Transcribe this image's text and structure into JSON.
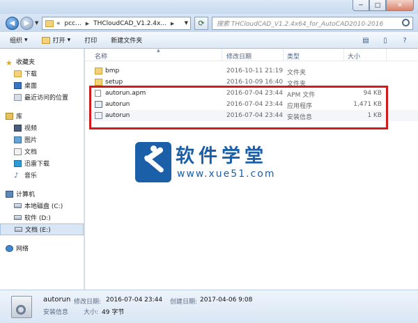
{
  "window": {
    "minimize": "─",
    "maximize": "□",
    "close": "✕"
  },
  "address": {
    "overflow": "«",
    "crumbs": [
      "pcc...",
      "THCloudCAD_V1.2.4x..."
    ],
    "separator": "▶"
  },
  "search": {
    "placeholder": "搜索 THCloudCAD_V1.2.4x64_for_AutoCAD2010-2016"
  },
  "toolbar": {
    "organize": "组织",
    "open": "打开",
    "print": "打印",
    "new_folder": "新建文件夹",
    "dropdown": "▼"
  },
  "sidebar": {
    "favorites": {
      "label": "收藏夹",
      "items": [
        "下载",
        "桌面",
        "最近访问的位置"
      ]
    },
    "libraries": {
      "label": "库",
      "items": [
        "视频",
        "图片",
        "文档",
        "迅雷下载",
        "音乐"
      ]
    },
    "computer": {
      "label": "计算机",
      "items": [
        "本地磁盘 (C:)",
        "软件 (D:)",
        "文档 (E:)"
      ]
    },
    "network": {
      "label": "网络"
    }
  },
  "columns": {
    "name": "名称",
    "date": "修改日期",
    "type": "类型",
    "size": "大小"
  },
  "files": [
    {
      "name": "bmp",
      "date": "2016-10-11 21:19",
      "type": "文件夹",
      "size": "",
      "icon": "folder-icon"
    },
    {
      "name": "setup",
      "date": "2016-10-09 16:40",
      "type": "文件夹",
      "size": "",
      "icon": "folder-icon"
    },
    {
      "name": "autorun.apm",
      "date": "2016-07-04 23:44",
      "type": "APM 文件",
      "size": "94 KB",
      "icon": "file-icon"
    },
    {
      "name": "autorun",
      "date": "2016-07-04 23:44",
      "type": "应用程序",
      "size": "1,471 KB",
      "icon": "exe-icon"
    },
    {
      "name": "autorun",
      "date": "2016-07-04 23:44",
      "type": "安装信息",
      "size": "1 KB",
      "icon": "inf-icon"
    }
  ],
  "watermark": {
    "title": "软件学堂",
    "url": "www.xue51.com"
  },
  "details": {
    "name": "autorun",
    "modified_label": "修改日期:",
    "modified_value": "2016-07-04 23:44",
    "created_label": "创建日期:",
    "created_value": "2017-04-06 9:08",
    "type": "安装信息",
    "size_label": "大小:",
    "size_value": "49 字节"
  },
  "colors": {
    "highlight_box": "#d21a1a",
    "brand_blue": "#1a5fa8"
  }
}
